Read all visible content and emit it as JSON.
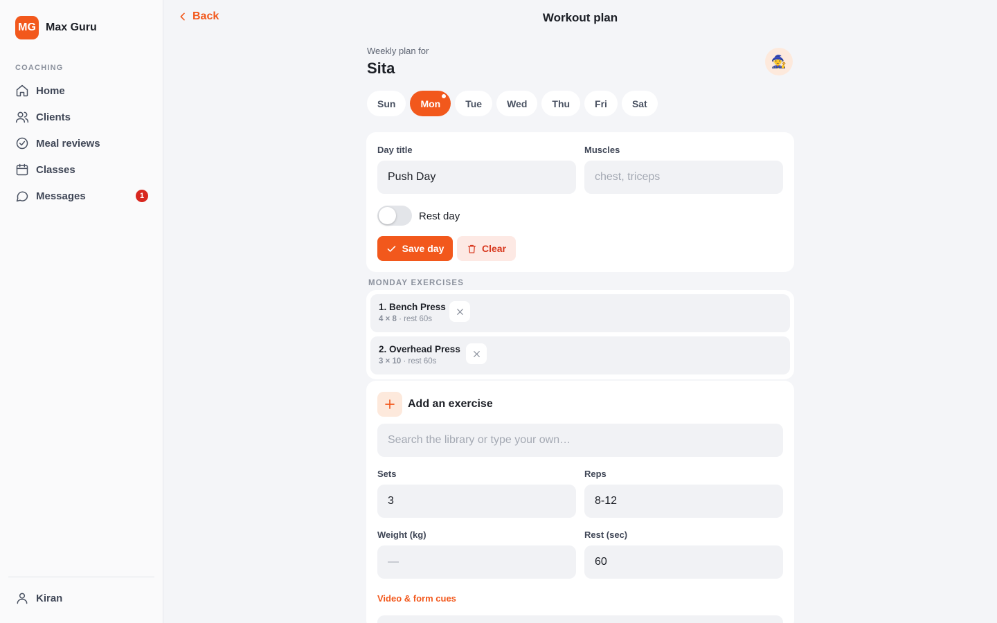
{
  "brand": {
    "initials": "MG",
    "name": "Max Guru",
    "accent": "#f2581c"
  },
  "sidebar": {
    "section": "COACHING",
    "items": [
      {
        "label": "Home",
        "icon": "home-icon"
      },
      {
        "label": "Clients",
        "icon": "users-icon"
      },
      {
        "label": "Meal reviews",
        "icon": "check-circle-icon"
      },
      {
        "label": "Classes",
        "icon": "calendar-icon"
      },
      {
        "label": "Messages",
        "icon": "message-icon",
        "badge": "1"
      }
    ],
    "user": "Kiran"
  },
  "header": {
    "back_label": "Back",
    "title": "Workout plan"
  },
  "plan": {
    "subtitle": "Weekly plan for",
    "client": "Sita",
    "avatar": "🧙",
    "days": [
      "Sun",
      "Mon",
      "Tue",
      "Wed",
      "Thu",
      "Fri",
      "Sat"
    ],
    "active_day": "Mon"
  },
  "day_form": {
    "title_label": "Day title",
    "title_value": "Push Day",
    "muscles_label": "Muscles",
    "muscles_placeholder": "chest, triceps",
    "rest_day_label": "Rest day",
    "rest_day_on": false,
    "save_label": "Save day",
    "clear_label": "Clear"
  },
  "exercises": {
    "section_label": "MONDAY EXERCISES",
    "items": [
      {
        "name": "1. Bench Press",
        "scheme": "4 × 8",
        "rest": " · rest 60s"
      },
      {
        "name": "2. Overhead Press",
        "scheme": "3 × 10",
        "rest": " · rest 60s"
      }
    ]
  },
  "add_exercise": {
    "title": "Add an exercise",
    "search_placeholder": "Search the library or type your own…",
    "sets_label": "Sets",
    "sets_value": "3",
    "reps_label": "Reps",
    "reps_value": "8-12",
    "weight_label": "Weight (kg)",
    "weight_placeholder": "—",
    "rest_label": "Rest (sec)",
    "rest_value": "60",
    "video_label": "Video & form cues"
  }
}
